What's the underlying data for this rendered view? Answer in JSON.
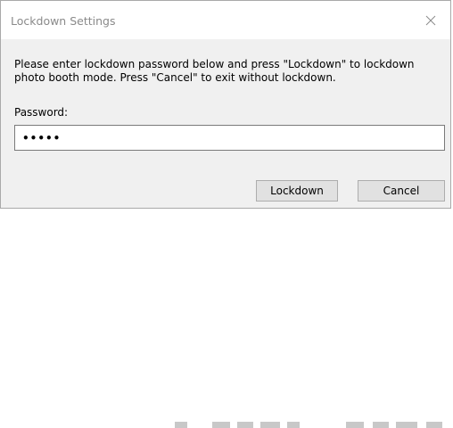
{
  "dialog": {
    "title": "Lockdown Settings",
    "close_icon": "close-icon"
  },
  "message": "Please enter lockdown password below and press \"Lockdown\" to lockdown photo booth mode. Press \"Cancel\" to exit without lockdown.",
  "password": {
    "label": "Password:",
    "value": "•••••"
  },
  "buttons": {
    "lockdown_label": "Lockdown",
    "cancel_label": "Cancel"
  },
  "colors": {
    "dialog_background": "#f0f0f0",
    "titlebar_background": "#ffffff",
    "title_text": "#8a8a8a",
    "button_background": "#e1e1e1",
    "button_border": "#adadad"
  }
}
